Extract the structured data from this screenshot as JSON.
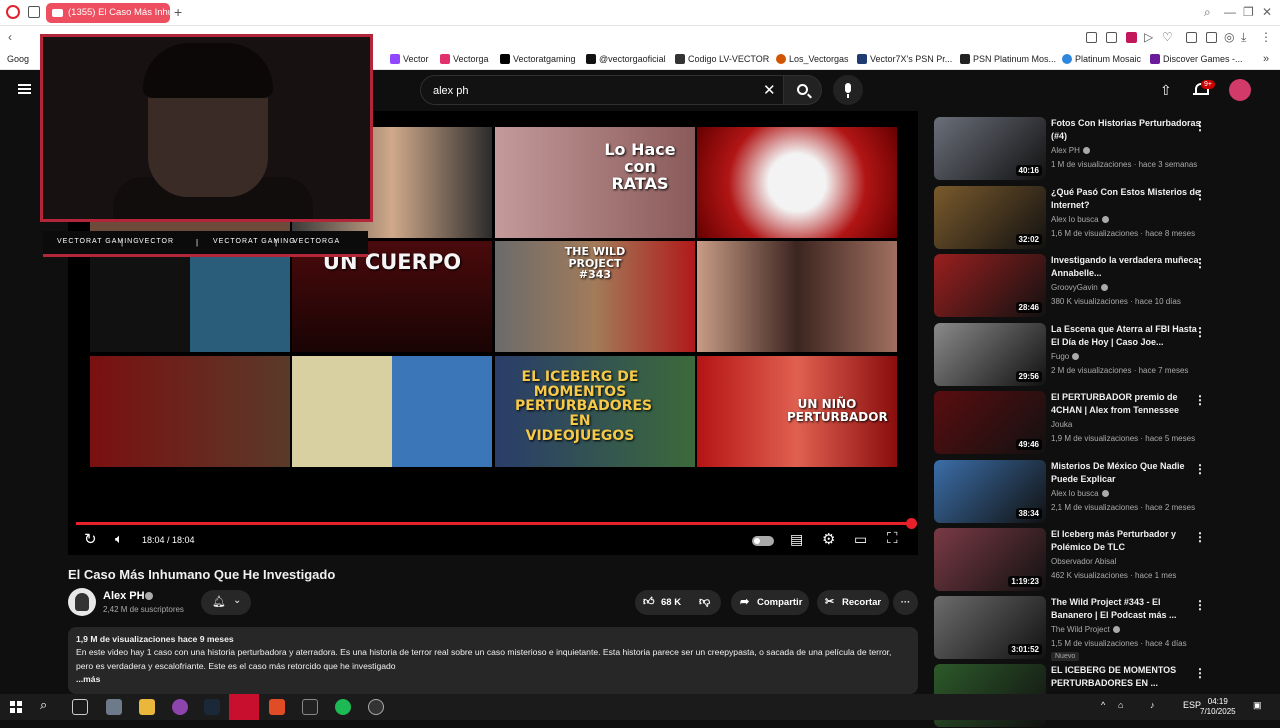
{
  "browser": {
    "tab_title": "(1355) El Caso Más Inhum",
    "bookmarks": [
      "Vector",
      "Vectorga",
      "Vectoratgaming",
      "@vectorgaoficial",
      "Codigo LV-VECTOR",
      "Los_Vectorgas",
      "Vector7X's PSN Pr...",
      "PSN Platinum Mos...",
      "Platinum Mosaic",
      "Discover Games -..."
    ],
    "bookmark_first": "Goog"
  },
  "youtube": {
    "search_value": "alex ph",
    "notification_count": "9+"
  },
  "player": {
    "time": "18:04 / 18:04",
    "progress": 1.0,
    "social": [
      "VECTORAT GAMING",
      "VECTOR",
      "VECTORAT GAMING",
      "VECTORGA"
    ],
    "thumb_texts": [
      "Lo Hace con RATAS",
      "UN CUERPO",
      "THE WILD PROJECT #343",
      "EL ICEBERG DE MOMENTOS PERTURBADORES EN VIDEOJUEGOS",
      "UN NIÑO PERTURBADOR"
    ]
  },
  "video": {
    "title": "El Caso Más Inhumano Que He Investigado",
    "channel": "Alex PH",
    "subscribers": "2,42 M de suscriptores",
    "likes": "68 K",
    "share": "Compartir",
    "clip": "Recortar",
    "meta": "1,9 M de visualizaciones  hace 9 meses",
    "description": "En este video hay 1 caso con una historia perturbadora y aterradora. Es una historia de terror real sobre un caso misterioso e inquietante. Esta historia parece ser un creepypasta, o sacada de una película de terror, pero es verdadera y escalofriante. Este es el caso más retorcido que he investigado",
    "more": "...más"
  },
  "recommendations": [
    {
      "title": "Fotos Con Historias Perturbadoras (#4)",
      "channel": "Alex PH",
      "verified": true,
      "views": "1 M de visualizaciones · hace 3 semanas",
      "duration": "40:16",
      "color": "#6b6f7a"
    },
    {
      "title": "¿Qué Pasó Con Estos Misterios de Internet?",
      "channel": "Alex lo busca",
      "verified": true,
      "views": "1,6 M de visualizaciones · hace 8 meses",
      "duration": "32:02",
      "color": "#7a5a2c"
    },
    {
      "title": "Investigando la verdadera muñeca Annabelle...",
      "channel": "GroovyGavin",
      "verified": true,
      "views": "380 K visualizaciones · hace 10 días",
      "duration": "28:46",
      "color": "#9a1f1f"
    },
    {
      "title": "La Escena que Aterra al FBI Hasta El Día de Hoy | Caso Joe...",
      "channel": "Fugo",
      "verified": true,
      "views": "2 M de visualizaciones · hace 7 meses",
      "duration": "29:56",
      "color": "#8a8a8a"
    },
    {
      "title": "El PERTURBADOR premio de 4CHAN | Alex from Tennessee",
      "channel": "Jouka",
      "verified": false,
      "views": "1,9 M de visualizaciones · hace 5 meses",
      "duration": "49:46",
      "color": "#5a0d10"
    },
    {
      "title": "Misterios De México Que Nadie Puede Explicar",
      "channel": "Alex lo busca",
      "verified": true,
      "views": "2,1 M de visualizaciones · hace 2 meses",
      "duration": "38:34",
      "color": "#3b6ea8"
    },
    {
      "title": "El Iceberg más Perturbador y Polémico De TLC",
      "channel": "Observador Abisal",
      "verified": false,
      "views": "462 K visualizaciones · hace 1 mes",
      "duration": "1:19:23",
      "color": "#7a3a45"
    },
    {
      "title": "The Wild Project #343 - El Bananero | El Podcast más ...",
      "channel": "The Wild Project",
      "verified": true,
      "views": "1,5 M de visualizaciones · hace 4 días",
      "duration": "3:01:52",
      "color": "#6c6c6c",
      "badge": "Nuevo"
    },
    {
      "title": "EL ICEBERG DE MOMENTOS PERTURBADORES EN ...",
      "channel": "",
      "verified": false,
      "views": "",
      "duration": "",
      "color": "#2d5a2a"
    }
  ],
  "taskbar": {
    "time": "04:19",
    "date": "7/10/2025",
    "lang": "ESP"
  }
}
